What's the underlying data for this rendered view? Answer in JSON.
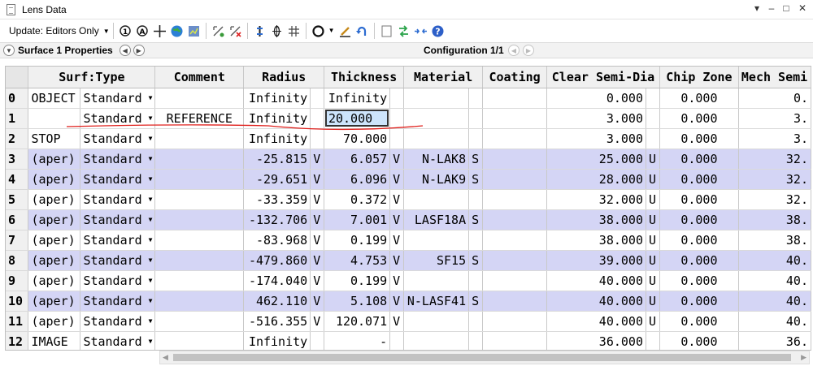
{
  "window": {
    "title": "Lens Data",
    "minimize": "–",
    "restore": "□",
    "close": "✕",
    "menu": "▾"
  },
  "toolbar": {
    "update_label": "Update: Editors Only",
    "icons": [
      "zoom-in-icon",
      "zoom-out-icon",
      "crosshair-icon",
      "globe-icon",
      "chart-icon",
      "add-surface-icon",
      "delete-surface-icon",
      "vertical-icon",
      "rings-icon",
      "fixture-icon",
      "circle-tool-icon",
      "draw-icon",
      "undo-icon",
      "page-icon",
      "arrows-icon",
      "fit-icon",
      "help-icon"
    ]
  },
  "properties_bar": {
    "surface_label": "Surface  1 Properties",
    "configuration_label": "Configuration 1/1"
  },
  "columns": [
    "Surf:Type",
    "Comment",
    "Radius",
    "Thickness",
    "Material",
    "Coating",
    "Clear Semi-Dia",
    "Chip Zone",
    "Mech Semi"
  ],
  "rows": [
    {
      "n": "0",
      "label": "OBJECT",
      "type": "Standard",
      "comment": "",
      "radius": "Infinity",
      "rsolve": "",
      "thickness": "Infinity",
      "tsolve": "",
      "material": "",
      "msolve": "",
      "coating": "",
      "clear": "0.000",
      "csolve": "",
      "chip": "0.000",
      "mech": "0.",
      "shade": false
    },
    {
      "n": "1",
      "label": "",
      "type": "Standard",
      "comment": "REFERENCE",
      "radius": "Infinity",
      "rsolve": "",
      "thickness": "20.000",
      "tsolve": "",
      "material": "",
      "msolve": "",
      "coating": "",
      "clear": "3.000",
      "csolve": "",
      "chip": "0.000",
      "mech": "3.",
      "shade": false,
      "selected": true
    },
    {
      "n": "2",
      "label": "STOP",
      "type": "Standard",
      "comment": "",
      "radius": "Infinity",
      "rsolve": "",
      "thickness": "70.000",
      "tsolve": "",
      "material": "",
      "msolve": "",
      "coating": "",
      "clear": "3.000",
      "csolve": "",
      "chip": "0.000",
      "mech": "3.",
      "shade": false
    },
    {
      "n": "3",
      "label": "(aper)",
      "type": "Standard",
      "comment": "",
      "radius": "-25.815",
      "rsolve": "V",
      "thickness": "6.057",
      "tsolve": "V",
      "material": "N-LAK8",
      "msolve": "S",
      "coating": "",
      "clear": "25.000",
      "csolve": "U",
      "chip": "0.000",
      "mech": "32.",
      "shade": true
    },
    {
      "n": "4",
      "label": "(aper)",
      "type": "Standard",
      "comment": "",
      "radius": "-29.651",
      "rsolve": "V",
      "thickness": "6.096",
      "tsolve": "V",
      "material": "N-LAK9",
      "msolve": "S",
      "coating": "",
      "clear": "28.000",
      "csolve": "U",
      "chip": "0.000",
      "mech": "32.",
      "shade": true
    },
    {
      "n": "5",
      "label": "(aper)",
      "type": "Standard",
      "comment": "",
      "radius": "-33.359",
      "rsolve": "V",
      "thickness": "0.372",
      "tsolve": "V",
      "material": "",
      "msolve": "",
      "coating": "",
      "clear": "32.000",
      "csolve": "U",
      "chip": "0.000",
      "mech": "32.",
      "shade": false
    },
    {
      "n": "6",
      "label": "(aper)",
      "type": "Standard",
      "comment": "",
      "radius": "-132.706",
      "rsolve": "V",
      "thickness": "7.001",
      "tsolve": "V",
      "material": "LASF18A",
      "msolve": "S",
      "coating": "",
      "clear": "38.000",
      "csolve": "U",
      "chip": "0.000",
      "mech": "38.",
      "shade": true
    },
    {
      "n": "7",
      "label": "(aper)",
      "type": "Standard",
      "comment": "",
      "radius": "-83.968",
      "rsolve": "V",
      "thickness": "0.199",
      "tsolve": "V",
      "material": "",
      "msolve": "",
      "coating": "",
      "clear": "38.000",
      "csolve": "U",
      "chip": "0.000",
      "mech": "38.",
      "shade": false
    },
    {
      "n": "8",
      "label": "(aper)",
      "type": "Standard",
      "comment": "",
      "radius": "-479.860",
      "rsolve": "V",
      "thickness": "4.753",
      "tsolve": "V",
      "material": "SF15",
      "msolve": "S",
      "coating": "",
      "clear": "39.000",
      "csolve": "U",
      "chip": "0.000",
      "mech": "40.",
      "shade": true
    },
    {
      "n": "9",
      "label": "(aper)",
      "type": "Standard",
      "comment": "",
      "radius": "-174.040",
      "rsolve": "V",
      "thickness": "0.199",
      "tsolve": "V",
      "material": "",
      "msolve": "",
      "coating": "",
      "clear": "40.000",
      "csolve": "U",
      "chip": "0.000",
      "mech": "40.",
      "shade": false
    },
    {
      "n": "10",
      "label": "(aper)",
      "type": "Standard",
      "comment": "",
      "radius": "462.110",
      "rsolve": "V",
      "thickness": "5.108",
      "tsolve": "V",
      "material": "N-LASF41",
      "msolve": "S",
      "coating": "",
      "clear": "40.000",
      "csolve": "U",
      "chip": "0.000",
      "mech": "40.",
      "shade": true
    },
    {
      "n": "11",
      "label": "(aper)",
      "type": "Standard",
      "comment": "",
      "radius": "-516.355",
      "rsolve": "V",
      "thickness": "120.071",
      "tsolve": "V",
      "material": "",
      "msolve": "",
      "coating": "",
      "clear": "40.000",
      "csolve": "U",
      "chip": "0.000",
      "mech": "40.",
      "shade": false
    },
    {
      "n": "12",
      "label": "IMAGE",
      "type": "Standard",
      "comment": "",
      "radius": "Infinity",
      "rsolve": "",
      "thickness": "-",
      "tsolve": "",
      "material": "",
      "msolve": "",
      "coating": "",
      "clear": "36.000",
      "csolve": "",
      "chip": "0.000",
      "mech": "36.",
      "shade": false
    }
  ],
  "colors": {
    "shade": "#d4d5f5",
    "selection": "#cde4fb",
    "annotation": "#e0201c"
  }
}
